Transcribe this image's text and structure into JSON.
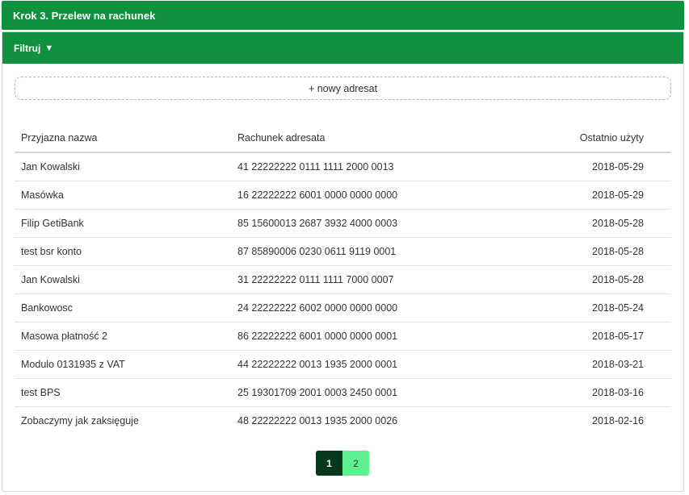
{
  "step": {
    "title": "Krok 3. Przelew na rachunek"
  },
  "filter": {
    "label": "Filtruj",
    "caret": "▼"
  },
  "new_recipient": {
    "label": "+ nowy adresat"
  },
  "table": {
    "headers": {
      "name": "Przyjazna nazwa",
      "account": "Rachunek adresata",
      "last_used": "Ostatnio użyty"
    },
    "rows": [
      {
        "name": "Jan Kowalski",
        "account": "41 22222222 0111 1111 2000 0013",
        "last_used": "2018-05-29"
      },
      {
        "name": "Masówka",
        "account": "16 22222222 6001 0000 0000 0000",
        "last_used": "2018-05-29"
      },
      {
        "name": "Filip GetiBank",
        "account": "85 15600013 2687 3932 4000 0003",
        "last_used": "2018-05-28"
      },
      {
        "name": "test bsr konto",
        "account": "87 85890006 0230 0611 9119 0001",
        "last_used": "2018-05-28"
      },
      {
        "name": "Jan Kowalski",
        "account": "31 22222222 0111 1111 7000 0007",
        "last_used": "2018-05-28"
      },
      {
        "name": "Bankowosc",
        "account": "24 22222222 6002 0000 0000 0000",
        "last_used": "2018-05-24"
      },
      {
        "name": "Masowa płatność 2",
        "account": "86 22222222 6001 0000 0000 0001",
        "last_used": "2018-05-17"
      },
      {
        "name": "Modulo 0131935 z VAT",
        "account": "44 22222222 0013 1935 2000 0001",
        "last_used": "2018-03-21"
      },
      {
        "name": "test BPS",
        "account": "25 19301709 2001 0003 2450 0001",
        "last_used": "2018-03-16"
      },
      {
        "name": "Zobaczymy jak zaksięguje",
        "account": "48 22222222 0013 1935 2000 0026",
        "last_used": "2018-02-16"
      }
    ]
  },
  "pagination": {
    "pages": [
      "1",
      "2"
    ],
    "current": "1"
  },
  "colors": {
    "header_green": "#0f9140",
    "page_active": "#063a1c",
    "page_other": "#5cf08e"
  }
}
